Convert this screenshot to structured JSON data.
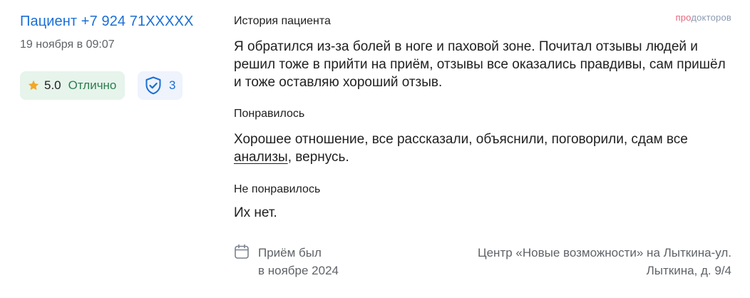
{
  "review": {
    "author": "Пациент +7 924 71XXXXX",
    "date": "19 ноября в 09:07",
    "rating_value": "5.0",
    "rating_text": "Отлично",
    "verification_count": "3"
  },
  "brand": {
    "part1": "про",
    "part2": "докторов"
  },
  "sections": {
    "history": {
      "title": "История пациента",
      "body": "Я обратился из-за болей в ноге и паховой зоне. Почитал отзывы людей и решил тоже в прийти на приём, отзывы все оказались правдивы, сам пришёл и тоже оставляю хороший отзыв."
    },
    "liked": {
      "title": "Понравилось",
      "body_before": "Хорошее отношение, все рассказали, объяснили, поговорили, сдам все ",
      "link": "анализы",
      "body_after": ", вернусь."
    },
    "disliked": {
      "title": "Не понравилось",
      "body": "Их нет."
    }
  },
  "footer": {
    "visit_line1": "Приём был",
    "visit_line2": "в ноябре 2024",
    "clinic_line1": "Центр «Новые возможности» на Лыткина-ул.",
    "clinic_line2": "Лыткина, д. 9/4"
  },
  "colors": {
    "author_link": "#1a6fd6",
    "rating_bg": "#e6f4ec",
    "rating_text": "#2e7d4f",
    "verify_bg": "#eef3fc",
    "star": "#f5a623",
    "brand_pink": "#e8657b",
    "brand_grey": "#8e9bb3"
  },
  "icons": {
    "rating": "star-icon",
    "verify": "shield-check-icon",
    "visit": "calendar-icon"
  }
}
